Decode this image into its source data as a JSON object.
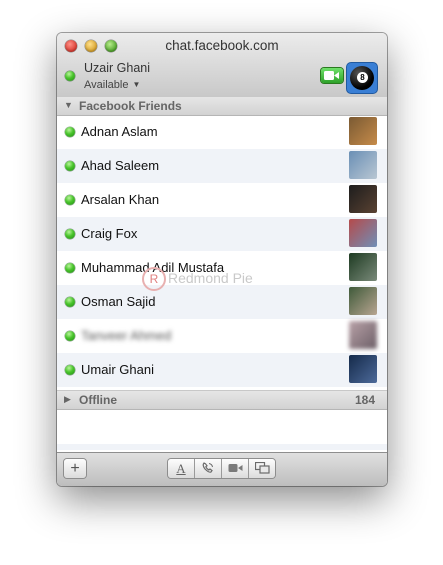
{
  "window": {
    "title": "chat.facebook.com"
  },
  "user": {
    "name": "Uzair Ghani",
    "status": "Available",
    "status_color": "#3fbf2a"
  },
  "groups": {
    "online": {
      "label": "Facebook Friends"
    },
    "offline": {
      "label": "Offline",
      "count": "184"
    }
  },
  "friends": [
    {
      "name": "Adnan Aslam",
      "avatar_colors": [
        "#7a5a33",
        "#c68b4a"
      ]
    },
    {
      "name": "Ahad Saleem",
      "avatar_colors": [
        "#6a8fb5",
        "#b9c7d3"
      ]
    },
    {
      "name": "Arsalan Khan",
      "avatar_colors": [
        "#1d1d1d",
        "#5a4232"
      ]
    },
    {
      "name": "Craig Fox",
      "avatar_colors": [
        "#b54a4a",
        "#6f8fb8"
      ]
    },
    {
      "name": "Muhammad Adil Mustafa",
      "avatar_colors": [
        "#1e3b22",
        "#7a8a7a"
      ]
    },
    {
      "name": "Osman Sajid",
      "avatar_colors": [
        "#3f5a3a",
        "#b8a591"
      ]
    },
    {
      "name": "Tanveer Ahmed",
      "avatar_colors": [
        "#b9a2a8",
        "#6c5f67"
      ]
    },
    {
      "name": "Umair Ghani",
      "avatar_colors": [
        "#152a4a",
        "#4d6a9a"
      ]
    }
  ],
  "watermark": {
    "text": "Redmond Pie"
  },
  "toolbar": {
    "add_label": "+",
    "text_label": "A",
    "icons": [
      "add-icon",
      "text-chat-icon",
      "voice-call-icon",
      "video-call-icon",
      "screen-share-icon"
    ]
  }
}
